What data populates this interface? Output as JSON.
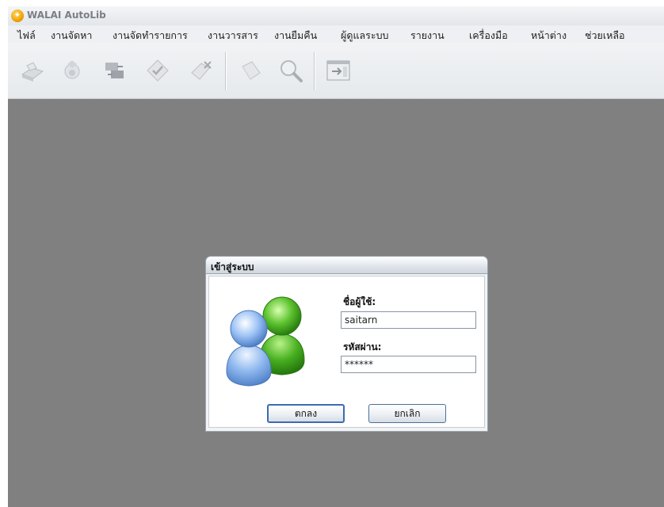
{
  "app": {
    "title": "WALAI AutoLib",
    "icon": "app-logo-icon"
  },
  "menu": [
    "ไฟล์",
    "งานจัดหา",
    "งานจัดทำรายการ",
    "งานวารสาร",
    "งานยืมคืน",
    "ผู้ดูแลระบบ",
    "รายงาน",
    "เครื่องมือ",
    "หน้าต่าง",
    "ช่วยเหลือ"
  ],
  "toolbar": {
    "icons": [
      "open-book-icon",
      "brush-icon",
      "transfer-icon",
      "check-tag-icon",
      "delete-tag-icon",
      "book-icon",
      "search-icon",
      "exit-window-icon"
    ]
  },
  "login": {
    "title": "เข้าสู่ระบบ",
    "username_label": "ชื่อผู้ใช้:",
    "username_value": "saitarn",
    "password_label": "รหัสผ่าน:",
    "password_value": "******",
    "ok_label": "ตกลง",
    "cancel_label": "ยกเลิก",
    "avatar_icon": "users-icon"
  },
  "colors": {
    "workspace": "#808080",
    "toolbar": "#e9ecef",
    "user_blue": "#5b8fd9",
    "user_green": "#3fa82a"
  }
}
